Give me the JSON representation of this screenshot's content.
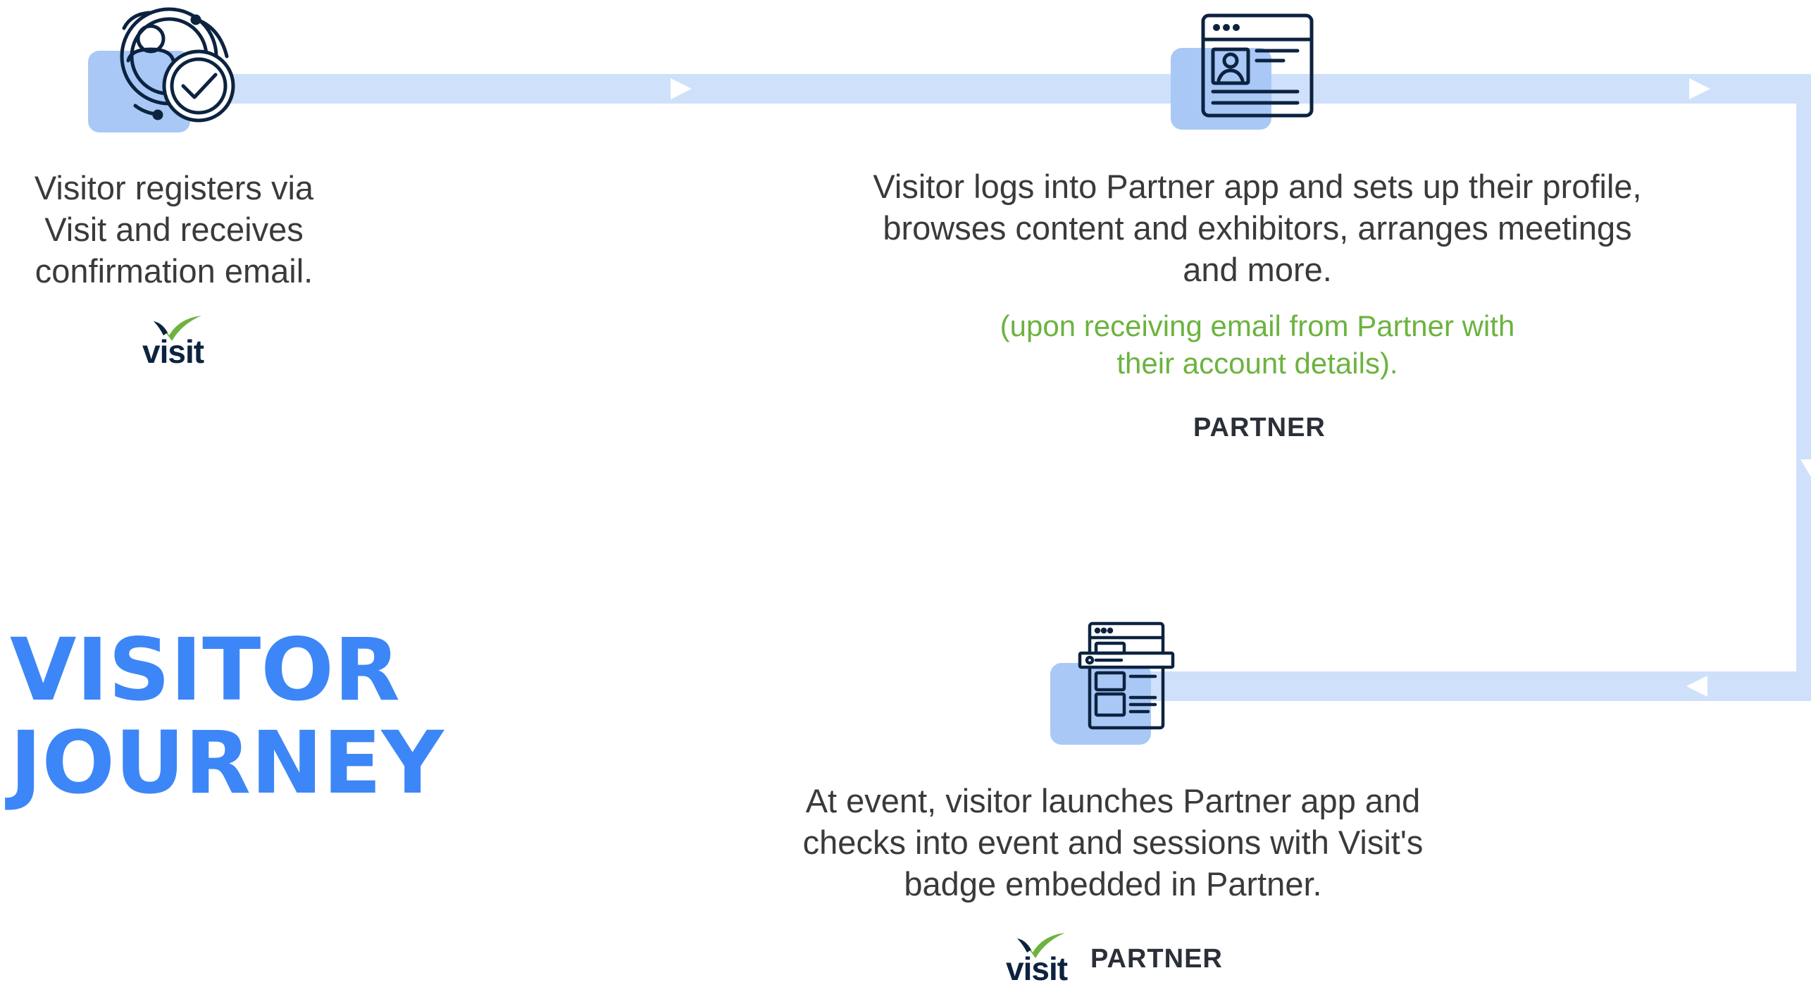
{
  "colors": {
    "flow_line": "#cfe0fb",
    "highlight": "#a9c8f6",
    "icon_stroke": "#0c2340",
    "title": "#3d86f7",
    "note": "#6cb33f",
    "text": "#3a3a3a",
    "visit_check": "#6cb33f",
    "partner_logo": "#2a2f38"
  },
  "title": {
    "line1": "VISITOR",
    "line2": "JOURNEY"
  },
  "steps": [
    {
      "icon": "user-check-icon",
      "lines": [
        "Visitor registers via",
        "Visit and receives",
        "confirmation email."
      ],
      "logos": [
        "visit"
      ]
    },
    {
      "icon": "browser-profile-icon",
      "lines": [
        "Visitor logs into Partner app and sets up their profile,",
        "browses content and exhibitors, arranges meetings",
        "and more."
      ],
      "note_lines": [
        "(upon receiving email from Partner with",
        "their account details)."
      ],
      "logos": [
        "partner"
      ]
    },
    {
      "icon": "app-windows-icon",
      "lines": [
        "At event, visitor launches Partner app and",
        "checks into event and sessions with Visit's",
        "badge embedded in Partner."
      ],
      "logos": [
        "visit",
        "partner"
      ]
    }
  ],
  "logos": {
    "visit_text": "visit",
    "partner_text": "PARTNER"
  }
}
